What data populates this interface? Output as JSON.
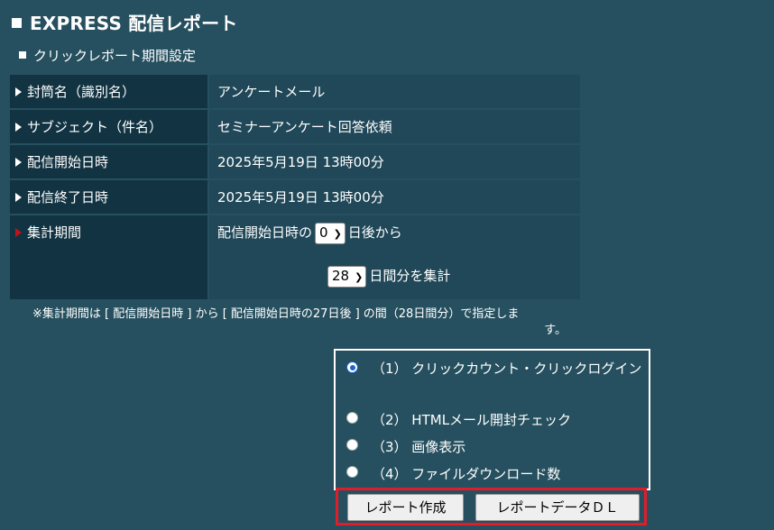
{
  "header": {
    "title": "EXPRESS 配信レポート"
  },
  "section": {
    "title": "クリックレポート期間設定"
  },
  "rows": [
    {
      "label": "封筒名（識別名）",
      "value": "アンケートメール"
    },
    {
      "label": "サブジェクト（件名）",
      "value": "セミナーアンケート回答依頼"
    },
    {
      "label": "配信開始日時",
      "value": "2025年5月19日 13時00分"
    },
    {
      "label": "配信終了日時",
      "value": "2025年5月19日 13時00分"
    }
  ],
  "period": {
    "label": "集計期間",
    "prefix": "配信開始日時の",
    "offset_value": "0",
    "offset_suffix": "日後から",
    "days_value": "28",
    "days_suffix": "日間分を集計"
  },
  "note": {
    "line1": "※集計期間は [ 配信開始日時 ] から [ 配信開始日時の27日後 ] の間（28日間分）で指定しま",
    "line2": "す。"
  },
  "options": [
    {
      "label": "（1） クリックカウント・クリックログイン",
      "selected": true
    },
    {
      "label": "（2） HTMLメール開封チェック",
      "selected": false
    },
    {
      "label": "（3） 画像表示",
      "selected": false
    },
    {
      "label": "（4） ファイルダウンロード数",
      "selected": false
    }
  ],
  "buttons": {
    "create": "レポート作成",
    "download": "レポートデータＤＬ"
  },
  "colors": {
    "background": "#26505f",
    "label_cell": "#123342",
    "value_cell": "#204858",
    "highlight": "#e11d2a",
    "radio": "#1a64d6"
  }
}
